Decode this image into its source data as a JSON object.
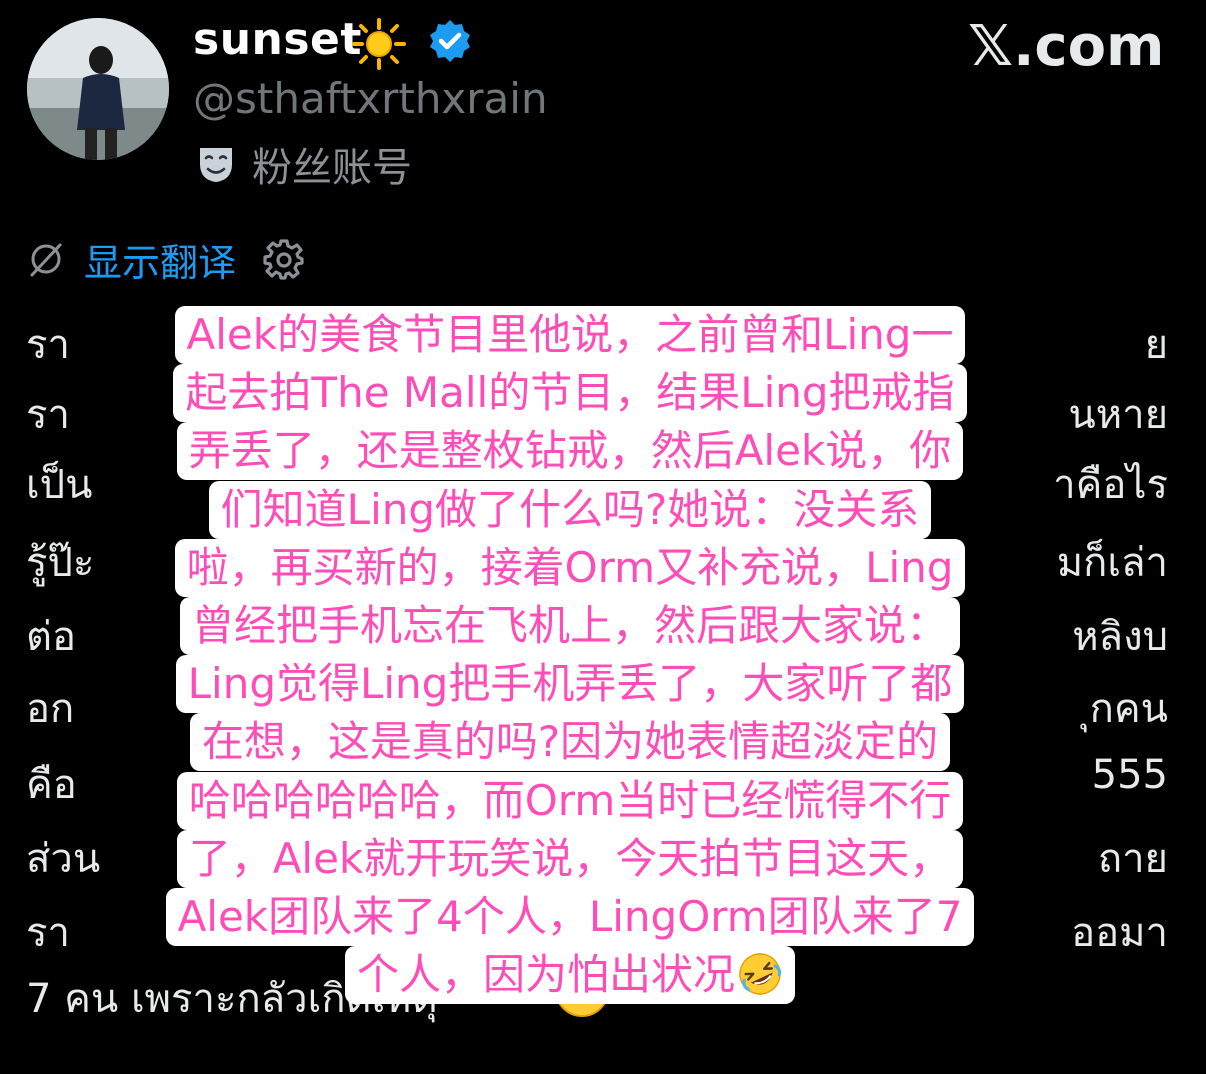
{
  "profile": {
    "display_name": "sunset",
    "handle": "@sthaftxrthxrain",
    "badge_label": "粉丝账号",
    "brand": "𝕏.com"
  },
  "translate": {
    "link_label": "显示翻译"
  },
  "tweet_thai_fragments": [
    {
      "id": "l1",
      "text": "รา"
    },
    {
      "id": "l1r",
      "text": "ย"
    },
    {
      "id": "l2",
      "text": "รา"
    },
    {
      "id": "l2r",
      "text": "นหาย"
    },
    {
      "id": "l3",
      "text": "เป็น"
    },
    {
      "id": "l3r",
      "text": "าคือไร"
    },
    {
      "id": "l4",
      "text": "รู้ป๊ะ"
    },
    {
      "id": "l4r",
      "text": "มก็เล่า"
    },
    {
      "id": "l5",
      "text": "ต่อ"
    },
    {
      "id": "l5r",
      "text": "หลิงบ"
    },
    {
      "id": "l6",
      "text": "อก"
    },
    {
      "id": "l6r",
      "text": "ุกคน"
    },
    {
      "id": "l7",
      "text": "คือ"
    },
    {
      "id": "l7r",
      "text": "555"
    },
    {
      "id": "l8",
      "text": "ส่วน"
    },
    {
      "id": "l8r",
      "text": "ถาย"
    },
    {
      "id": "l9",
      "text": "รา"
    },
    {
      "id": "l9r",
      "text": "ออมา"
    },
    {
      "id": "l10",
      "text": "7 คน เพราะกลัวเกิดเหตุ"
    }
  ],
  "overlay_lines": [
    "Alek的美食节目里他说，之前曾和Ling一",
    "起去拍The Mall的节目，结果Ling把戒指",
    "弄丢了，还是整枚钻戒，然后Alek说，你",
    "们知道Ling做了什么吗?她说：没关系",
    "啦，再买新的，接着Orm又补充说，Ling",
    "曾经把手机忘在飞机上，然后跟大家说：",
    "Ling觉得Ling把手机弄丢了，大家听了都",
    "在想，这是真的吗?因为她表情超淡定的",
    "哈哈哈哈哈哈，而Orm当时已经慌得不行",
    "了，Alek就开玩笑说，今天拍节目这天，",
    "Alek团队来了4个人，LingOrm团队来了7",
    "个人，因为怕出状况"
  ],
  "icons": {
    "sun": "sun-emoji",
    "verified": "verified-badge-icon",
    "mask": "theater-mask-icon",
    "no_translate": "no-translate-icon",
    "gear": "gear-icon",
    "laugh": "rolling-on-floor-laughing-emoji"
  },
  "colors": {
    "background": "#000000",
    "link": "#1d9bf0",
    "overlay_text": "#ff4db8",
    "overlay_bg": "#ffffff",
    "muted": "#71767b"
  }
}
